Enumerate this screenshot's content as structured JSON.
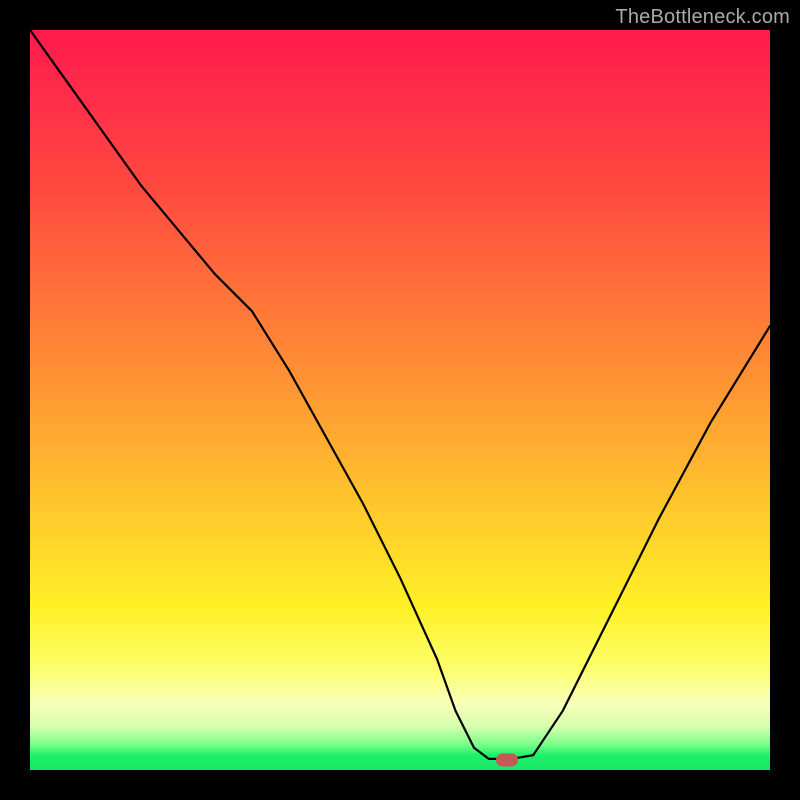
{
  "watermark": "TheBottleneck.com",
  "marker": {
    "x_frac": 0.645,
    "y_frac": 0.987
  },
  "chart_data": {
    "type": "line",
    "title": "",
    "xlabel": "",
    "ylabel": "",
    "xlim": [
      0,
      1
    ],
    "ylim": [
      0,
      1
    ],
    "series": [
      {
        "name": "bottleneck-curve",
        "x": [
          0.0,
          0.05,
          0.1,
          0.15,
          0.2,
          0.25,
          0.3,
          0.35,
          0.4,
          0.45,
          0.5,
          0.55,
          0.575,
          0.6,
          0.62,
          0.65,
          0.68,
          0.72,
          0.78,
          0.85,
          0.92,
          1.0
        ],
        "y": [
          1.0,
          0.93,
          0.86,
          0.79,
          0.73,
          0.67,
          0.62,
          0.54,
          0.45,
          0.36,
          0.26,
          0.15,
          0.08,
          0.03,
          0.015,
          0.015,
          0.02,
          0.08,
          0.2,
          0.34,
          0.47,
          0.6
        ]
      }
    ],
    "annotations": [
      {
        "text": "TheBottleneck.com",
        "role": "watermark"
      }
    ],
    "background_gradient_stops": [
      {
        "pos": 0.0,
        "color": "#ff1a4d"
      },
      {
        "pos": 0.33,
        "color": "#ff6a3a"
      },
      {
        "pos": 0.68,
        "color": "#ffd22a"
      },
      {
        "pos": 0.86,
        "color": "#fdff69"
      },
      {
        "pos": 0.97,
        "color": "#7fff8a"
      },
      {
        "pos": 1.0,
        "color": "#19e865"
      }
    ]
  }
}
